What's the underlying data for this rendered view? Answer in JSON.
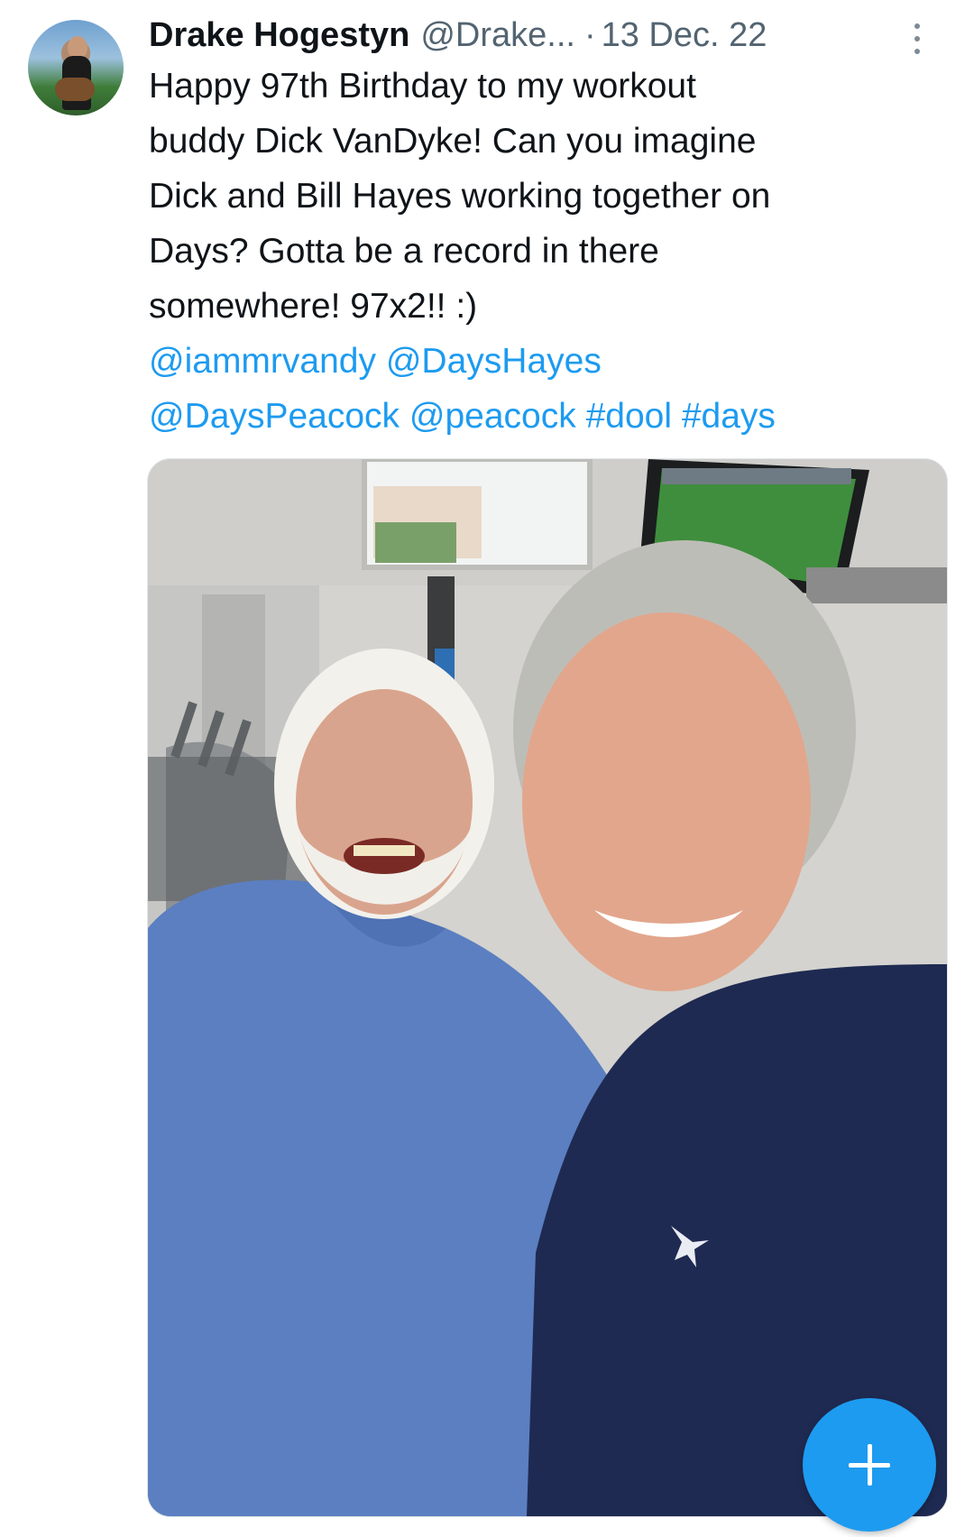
{
  "tweet": {
    "author_name": "Drake Hogestyn",
    "author_handle": "@Drake...",
    "separator": "·",
    "date": "13 Dec. 22",
    "text_lines": [
      "Happy 97th Birthday to my workout",
      "buddy Dick VanDyke! Can you imagine",
      "Dick and Bill Hayes working together on",
      "Days? Gotta be a record in there",
      "somewhere!  97x2!! :)"
    ],
    "links_line_1": [
      "@iammrvandy",
      "@DaysHayes"
    ],
    "links_line_2": [
      "@DaysPeacock",
      "@peacock",
      "#dool",
      "#days"
    ],
    "link_color": "#1d9bf0",
    "muted_color": "#536471"
  },
  "icons": {
    "more": "more-vertical-icon",
    "compose": "plus-icon"
  },
  "fab": {
    "color": "#1d9bf0"
  }
}
